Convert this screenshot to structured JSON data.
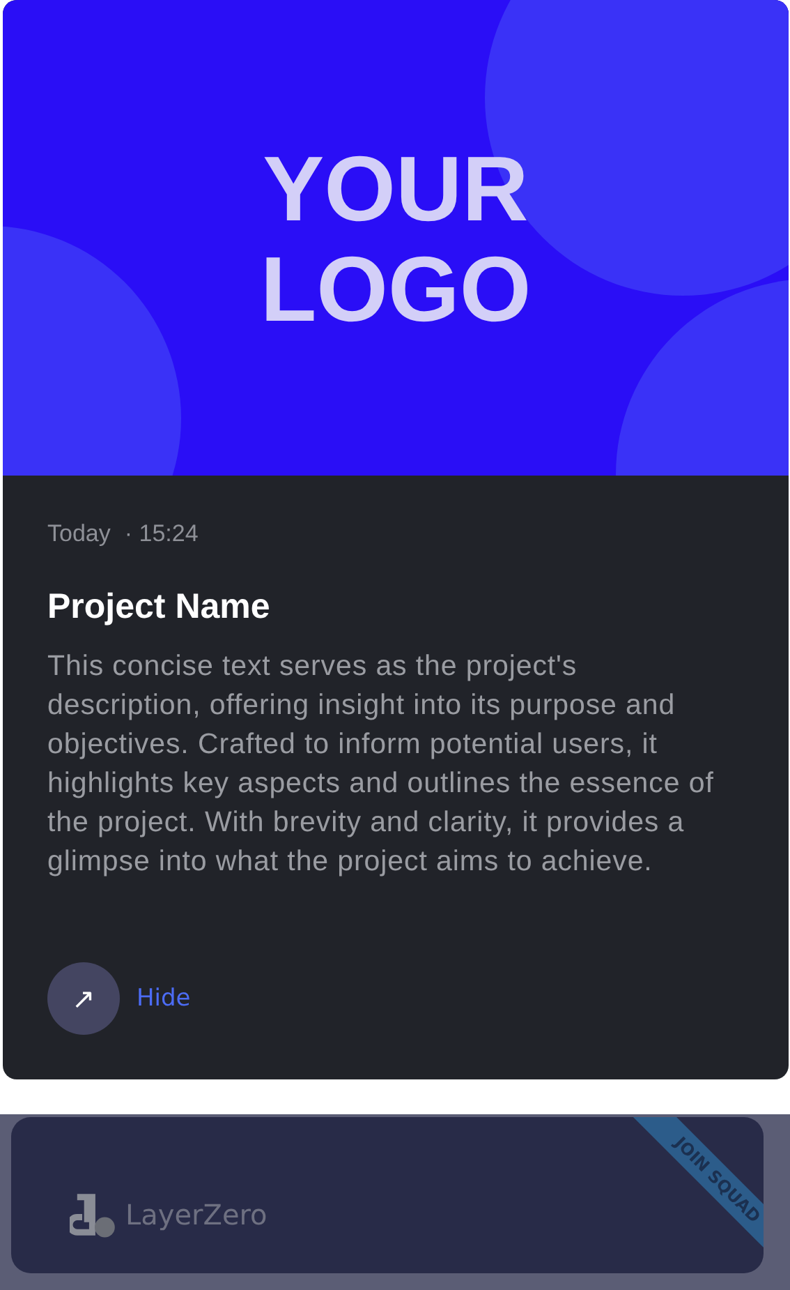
{
  "project_card": {
    "logo_lines": [
      "YOUR",
      "LOGO"
    ],
    "date": "Today",
    "time": "· 15:24",
    "title": "Project Name",
    "description": "This concise text serves as the project's description, offering insight into its purpose and objectives. Crafted to inform potential users, it highlights key aspects and outlines the essence of the project. With brevity and clarity, it provides a glimpse into what the project aims to achieve.",
    "action": {
      "icon": "↗",
      "label": "Hide"
    }
  },
  "preview_card": {
    "brand": "LayerZero",
    "ribbon": "JOIN SQUAD"
  }
}
